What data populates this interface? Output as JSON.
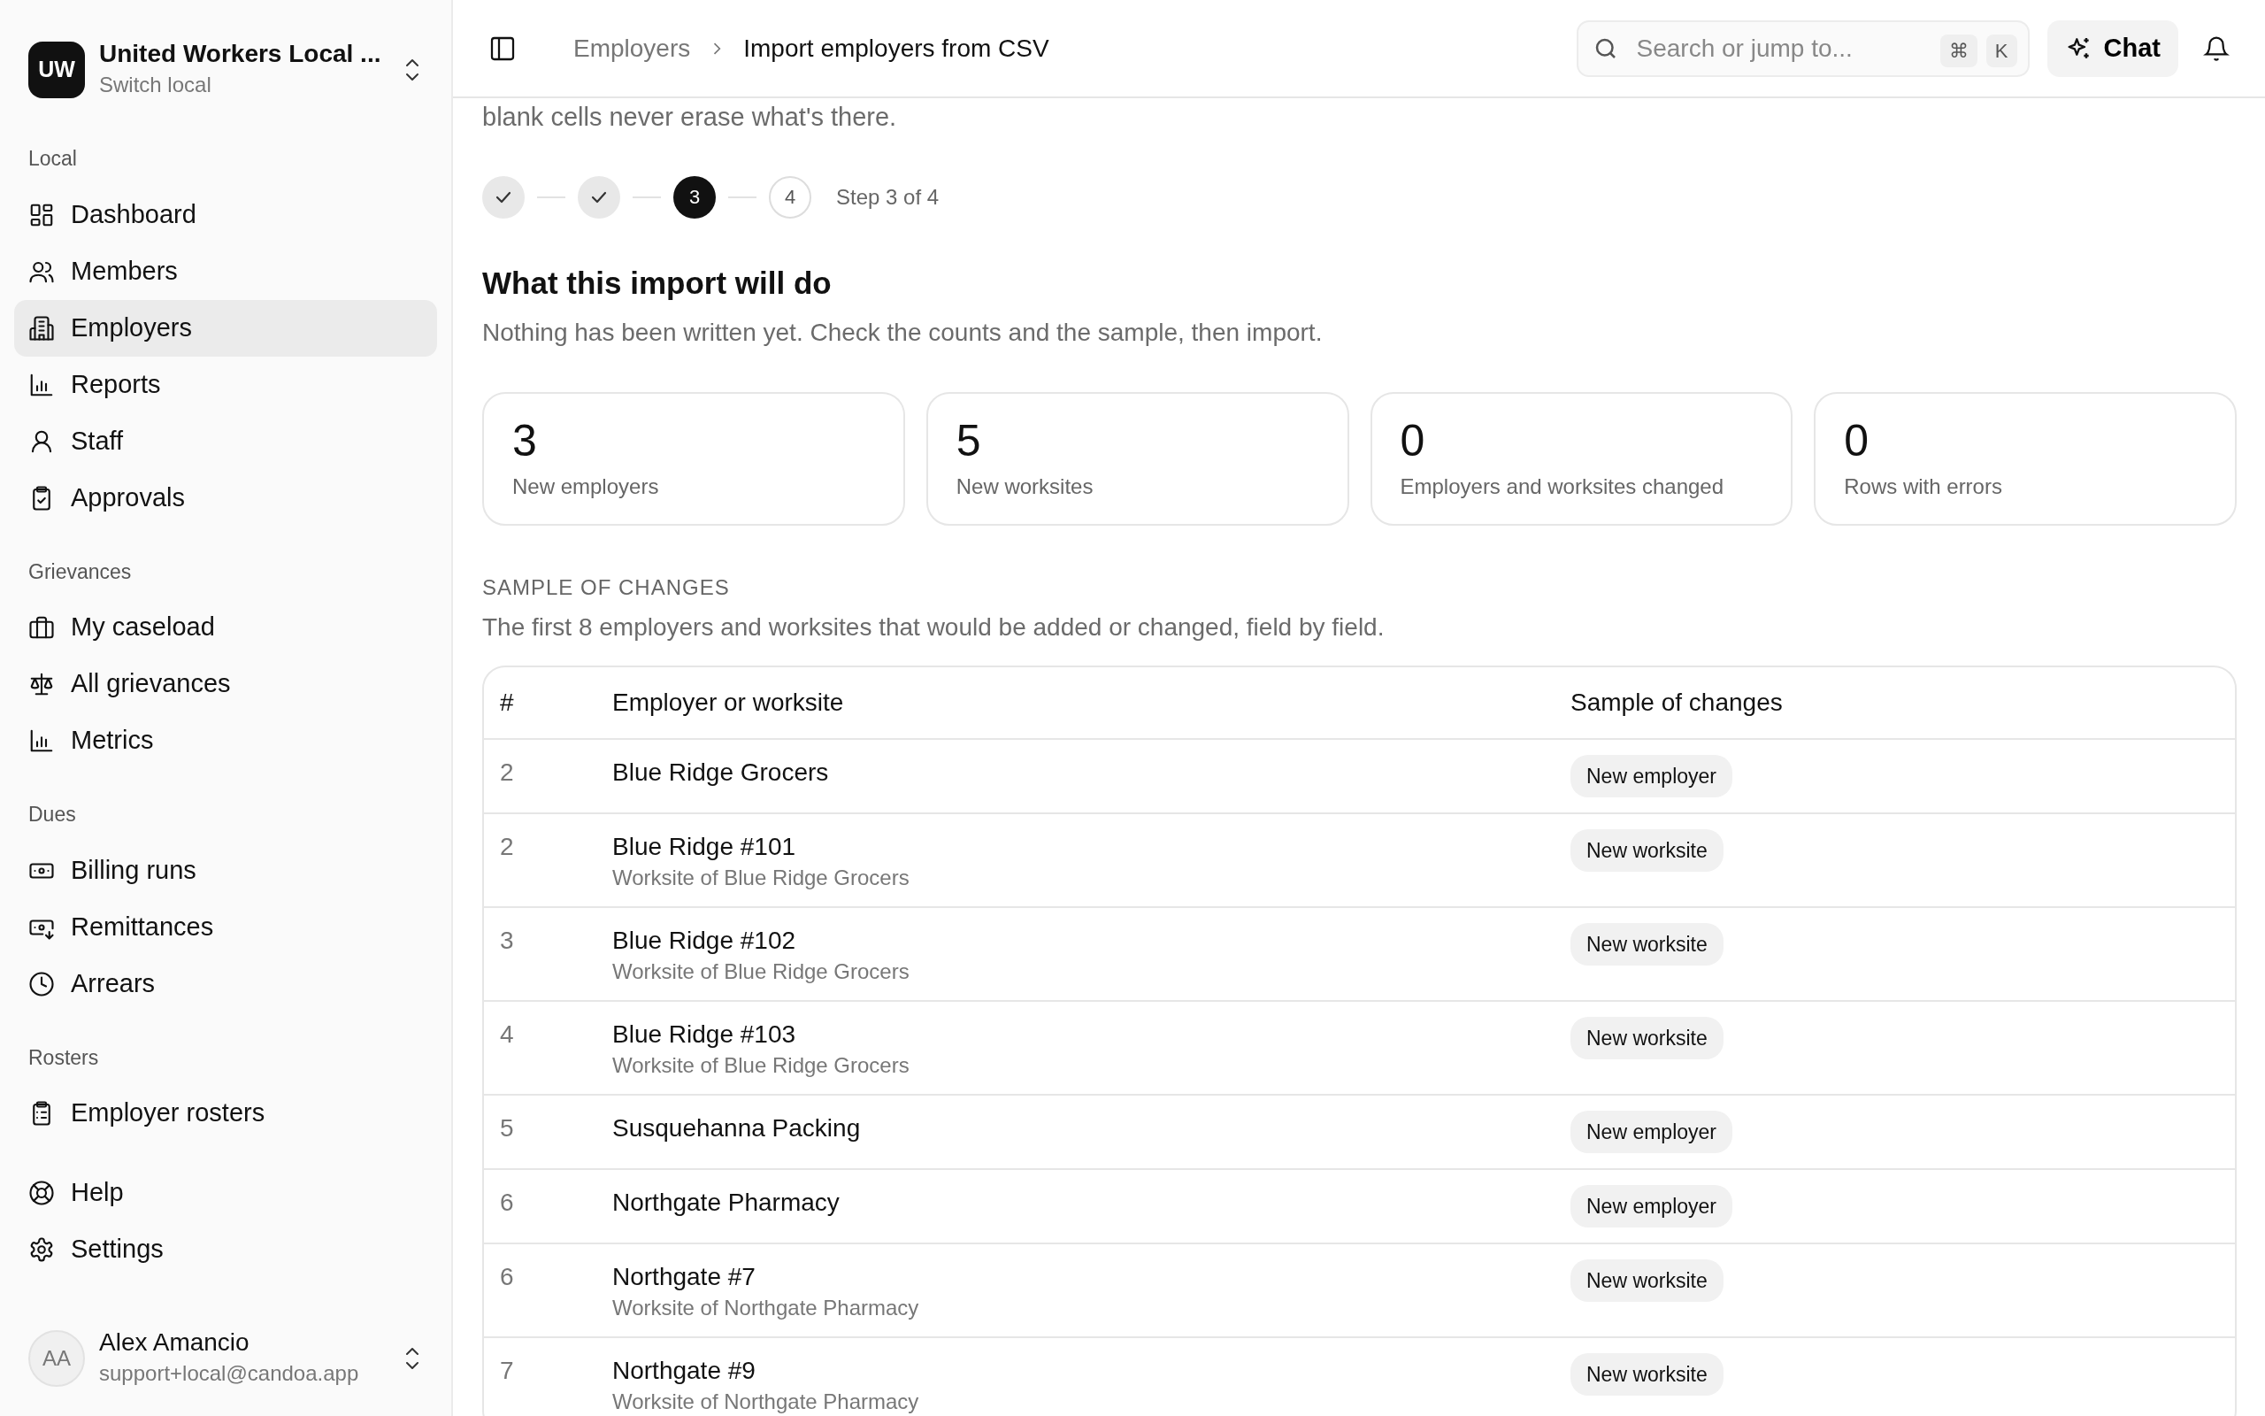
{
  "sidebar": {
    "org": {
      "initials": "UW",
      "name": "United Workers Local ...",
      "subtitle": "Switch local"
    },
    "sections": [
      {
        "title": "Local",
        "items": [
          {
            "label": "Dashboard",
            "selected": false
          },
          {
            "label": "Members",
            "selected": false
          },
          {
            "label": "Employers",
            "selected": true
          },
          {
            "label": "Reports",
            "selected": false
          },
          {
            "label": "Staff",
            "selected": false
          },
          {
            "label": "Approvals",
            "selected": false
          }
        ]
      },
      {
        "title": "Grievances",
        "items": [
          {
            "label": "My caseload",
            "selected": false
          },
          {
            "label": "All grievances",
            "selected": false
          },
          {
            "label": "Metrics",
            "selected": false
          }
        ]
      },
      {
        "title": "Dues",
        "items": [
          {
            "label": "Billing runs",
            "selected": false
          },
          {
            "label": "Remittances",
            "selected": false
          },
          {
            "label": "Arrears",
            "selected": false
          }
        ]
      },
      {
        "title": "Rosters",
        "items": [
          {
            "label": "Employer rosters",
            "selected": false
          }
        ]
      }
    ],
    "footer_items": [
      {
        "label": "Help",
        "selected": false
      },
      {
        "label": "Settings",
        "selected": false
      }
    ],
    "user": {
      "initials": "AA",
      "name": "Alex Amancio",
      "email": "support+local@candoa.app"
    }
  },
  "header": {
    "breadcrumbs": [
      "Employers",
      "Import employers from CSV"
    ],
    "search": {
      "placeholder": "Search or jump to...",
      "shortcut": [
        "⌘",
        "K"
      ]
    },
    "chat_button": "Chat"
  },
  "intro_tail": "blank cells never erase what's there.",
  "stepper": {
    "steps": [
      {
        "done": true,
        "current": false
      },
      {
        "done": true,
        "current": false
      },
      {
        "done": false,
        "current": true,
        "label": "3"
      },
      {
        "done": false,
        "current": false,
        "label": "4"
      }
    ],
    "caption": "Step 3 of 4"
  },
  "summary": {
    "title": "What this import will do",
    "description": "Nothing has been written yet. Check the counts and the sample, then import.",
    "stats": [
      {
        "value": "3",
        "label": "New employers"
      },
      {
        "value": "5",
        "label": "New worksites"
      },
      {
        "value": "0",
        "label": "Employers and worksites changed"
      },
      {
        "value": "0",
        "label": "Rows with errors"
      }
    ]
  },
  "sample": {
    "title": "SAMPLE OF CHANGES",
    "description": "The first 8 employers and worksites that would be added or changed, field by field.",
    "table": {
      "columns": [
        "#",
        "Employer or worksite",
        "Sample of changes"
      ],
      "rows": [
        {
          "row": "2",
          "name": "Blue Ridge Grocers",
          "change": "New employer"
        },
        {
          "row": "2",
          "name": "Blue Ridge #101",
          "detail": "Worksite of Blue Ridge Grocers",
          "change": "New worksite"
        },
        {
          "row": "3",
          "name": "Blue Ridge #102",
          "detail": "Worksite of Blue Ridge Grocers",
          "change": "New worksite"
        },
        {
          "row": "4",
          "name": "Blue Ridge #103",
          "detail": "Worksite of Blue Ridge Grocers",
          "change": "New worksite"
        },
        {
          "row": "5",
          "name": "Susquehanna Packing",
          "change": "New employer"
        },
        {
          "row": "6",
          "name": "Northgate Pharmacy",
          "change": "New employer"
        },
        {
          "row": "6",
          "name": "Northgate #7",
          "detail": "Worksite of Northgate Pharmacy",
          "change": "New worksite"
        },
        {
          "row": "7",
          "name": "Northgate #9",
          "detail": "Worksite of Northgate Pharmacy",
          "change": "New worksite"
        }
      ]
    }
  }
}
